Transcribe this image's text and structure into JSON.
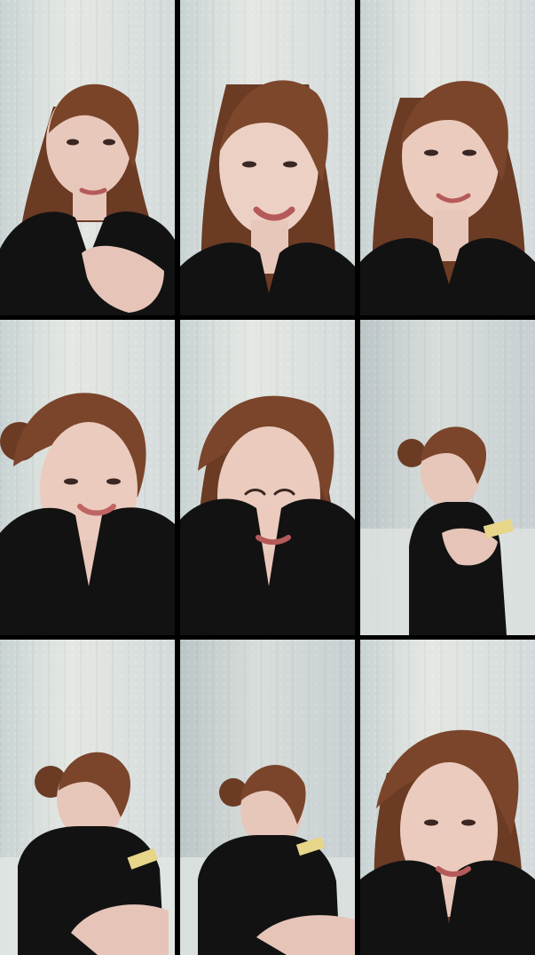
{
  "collage": {
    "tiles": [
      {
        "id": "tile-1",
        "variant": "close-up-hand-raised"
      },
      {
        "id": "tile-2",
        "variant": "close-up-talking"
      },
      {
        "id": "tile-3",
        "variant": "close-up-smile"
      },
      {
        "id": "tile-4",
        "variant": "bun-smile-tilted"
      },
      {
        "id": "tile-5",
        "variant": "bun-squint"
      },
      {
        "id": "tile-6",
        "variant": "seated-phone"
      },
      {
        "id": "tile-7",
        "variant": "seated-phone-close"
      },
      {
        "id": "tile-8",
        "variant": "seated-phone-2"
      },
      {
        "id": "tile-9",
        "variant": "close-up-lean"
      }
    ],
    "colors": {
      "background": "#000000",
      "curtain": "#e4e8e3",
      "shirt": "#111111",
      "hair": "#6b3b24",
      "skin": "#e7c7ba"
    }
  }
}
